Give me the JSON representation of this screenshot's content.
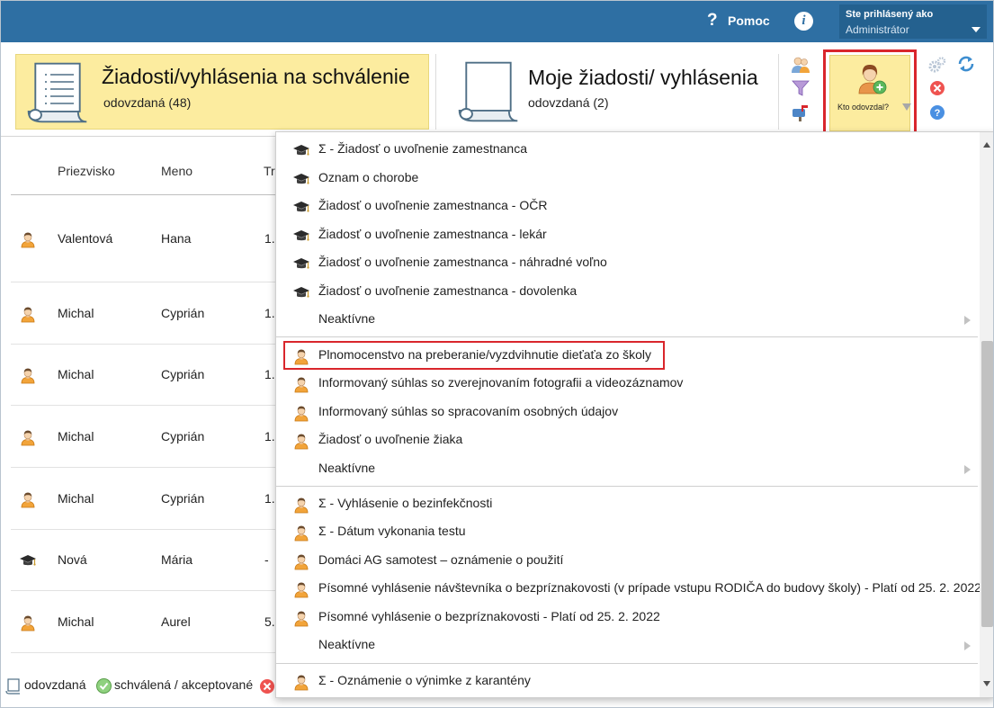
{
  "topbar": {
    "help_label": "Pomoc",
    "help_glyph": "?",
    "info_glyph": "i",
    "user_title": "Ste prihlásený ako",
    "user_name": "Administrátor"
  },
  "tiles": {
    "approval": {
      "title": "Žiadosti/vyhlásenia na schválenie",
      "subtitle": "odovzdaná (48)"
    },
    "mine": {
      "title": "Moje žiadosti/ vyhlásenia",
      "subtitle": "odovzdaná (2)"
    },
    "kto_odovzdal": {
      "label": "Kto odovzdal?"
    }
  },
  "table": {
    "headers": {
      "surname": "Priezvisko",
      "name": "Meno",
      "third": "Tr"
    },
    "rows": [
      {
        "icon": "user-icon",
        "surname": "Valentová",
        "name": "Hana",
        "third": "1."
      },
      {
        "icon": "user-icon",
        "surname": "Michal",
        "name": "Cyprián",
        "third": "1."
      },
      {
        "icon": "user-icon",
        "surname": "Michal",
        "name": "Cyprián",
        "third": "1."
      },
      {
        "icon": "user-icon",
        "surname": "Michal",
        "name": "Cyprián",
        "third": "1."
      },
      {
        "icon": "user-icon",
        "surname": "Michal",
        "name": "Cyprián",
        "third": "1."
      },
      {
        "icon": "graduation-cap-icon",
        "surname": "Nová",
        "name": "Mária",
        "third": "-"
      },
      {
        "icon": "user-icon",
        "surname": "Michal",
        "name": "Aurel",
        "third": "5."
      }
    ]
  },
  "legend": {
    "submitted": "odovzdaná",
    "approved": "schválená / akceptované"
  },
  "menu": {
    "items": [
      {
        "icon": "graduation-cap-icon",
        "label": "Σ - Žiadosť o uvoľnenie zamestnanca"
      },
      {
        "icon": "graduation-cap-icon",
        "label": "Oznam o chorobe"
      },
      {
        "icon": "graduation-cap-icon",
        "label": "Žiadosť o uvoľnenie zamestnanca - OČR"
      },
      {
        "icon": "graduation-cap-icon",
        "label": "Žiadosť o uvoľnenie zamestnanca - lekár"
      },
      {
        "icon": "graduation-cap-icon",
        "label": "Žiadosť o uvoľnenie zamestnanca - náhradné voľno"
      },
      {
        "icon": "graduation-cap-icon",
        "label": "Žiadosť o uvoľnenie zamestnanca - dovolenka"
      },
      {
        "icon": "none",
        "label": "Neaktívne",
        "submenu": true
      },
      {
        "icon": "user-icon",
        "label": "Plnomocenstvo na preberanie/vyzdvihnutie dieťaťa zo školy",
        "highlighted": true
      },
      {
        "icon": "user-icon",
        "label": "Informovaný súhlas so zverejnovaním fotografii a videozáznamov"
      },
      {
        "icon": "user-icon",
        "label": "Informovaný súhlas so spracovaním osobných údajov"
      },
      {
        "icon": "user-icon",
        "label": "Žiadosť o uvoľnenie žiaka"
      },
      {
        "icon": "none",
        "label": "Neaktívne",
        "submenu": true
      },
      {
        "icon": "user-icon",
        "label": "Σ - Vyhlásenie o bezinfekčnosti"
      },
      {
        "icon": "user-icon",
        "label": "Σ - Dátum vykonania testu"
      },
      {
        "icon": "user-icon",
        "label": "Domáci AG samotest – oznámenie o použití"
      },
      {
        "icon": "user-icon",
        "label": "Písomné vyhlásenie návštevníka o bezpríznakovosti (v prípade vstupu RODIČA do budovy školy) - Platí od 25. 2. 2022"
      },
      {
        "icon": "user-icon",
        "label": "Písomné vyhlásenie o bezpríznakovosti - Platí od 25. 2. 2022"
      },
      {
        "icon": "none",
        "label": "Neaktívne",
        "submenu": true
      },
      {
        "icon": "user-icon",
        "label": "Σ - Oznámenie o výnimke z karantény"
      }
    ]
  },
  "colors": {
    "topbar": "#2e6fa3",
    "active_tile": "#fcec9f",
    "highlight_border": "#d9262c"
  }
}
